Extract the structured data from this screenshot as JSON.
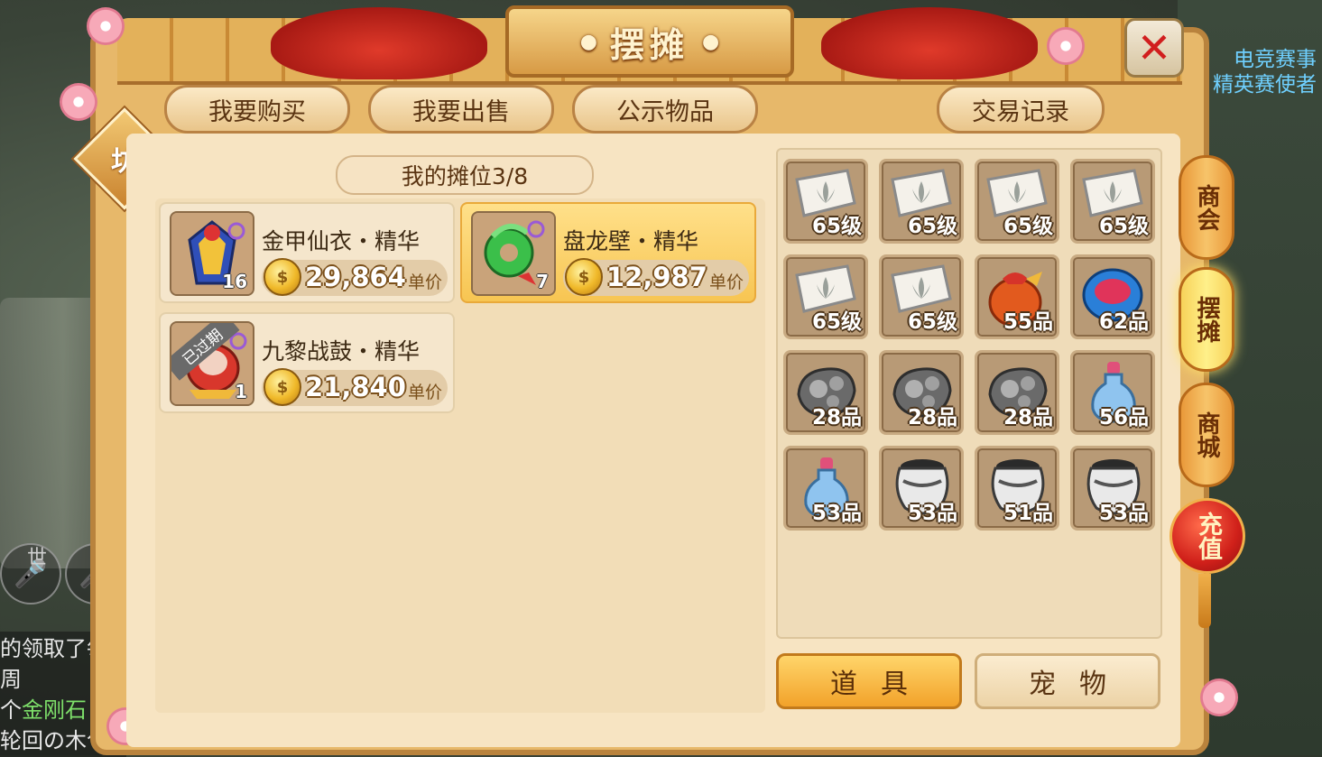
{
  "window": {
    "title": "摆摊",
    "close_icon": "close-icon"
  },
  "badge": {
    "label": "坊"
  },
  "tabs": [
    {
      "label": "我要购买"
    },
    {
      "label": "我要出售"
    },
    {
      "label": "公示物品"
    },
    {
      "label": "交易记录"
    }
  ],
  "stall": {
    "title": "我的摊位3/8",
    "items": [
      {
        "name": "金甲仙衣・精华",
        "price": "29,864",
        "unit": "单价",
        "count": "16",
        "selected": false,
        "expired": false
      },
      {
        "name": "盘龙壁・精华",
        "price": "12,987",
        "unit": "单价",
        "count": "7",
        "selected": true,
        "expired": false
      },
      {
        "name": "九黎战鼓・精华",
        "price": "21,840",
        "unit": "单价",
        "count": "1",
        "selected": false,
        "expired": true,
        "expired_label": "已过期"
      }
    ]
  },
  "coin_glyph": "$",
  "inventory": {
    "items": [
      {
        "icon": "scroll-icon",
        "level": "65级"
      },
      {
        "icon": "scroll-icon",
        "level": "65级"
      },
      {
        "icon": "scroll-icon",
        "level": "65级"
      },
      {
        "icon": "scroll-icon",
        "level": "65级"
      },
      {
        "icon": "scroll-icon",
        "level": "65级"
      },
      {
        "icon": "scroll-icon",
        "level": "65级"
      },
      {
        "icon": "pouch-icon",
        "level": "55品"
      },
      {
        "icon": "ring-icon",
        "level": "62品"
      },
      {
        "icon": "ore-icon",
        "level": "28品"
      },
      {
        "icon": "ore-icon",
        "level": "28品"
      },
      {
        "icon": "ore-icon",
        "level": "28品"
      },
      {
        "icon": "potion-icon",
        "level": "56品"
      },
      {
        "icon": "potion-icon",
        "level": "53品"
      },
      {
        "icon": "jar-icon",
        "level": "53品"
      },
      {
        "icon": "jar-icon",
        "level": "51品"
      },
      {
        "icon": "jar-icon",
        "level": "53品"
      }
    ],
    "buttons": {
      "items": "道具",
      "pets": "宠物"
    }
  },
  "side_tabs": {
    "commerce": "商会",
    "stall": "摆摊",
    "mall": "商城",
    "recharge": "充值"
  },
  "background": {
    "mic_labels": [
      "世",
      "门"
    ],
    "chat_lines": [
      {
        "text": "的领取了每周"
      },
      {
        "prefix": "个",
        "highlight": "金刚石"
      },
      {
        "text": "轮回の木兮"
      }
    ],
    "news": [
      "电竞赛事",
      "精英赛使者"
    ]
  }
}
